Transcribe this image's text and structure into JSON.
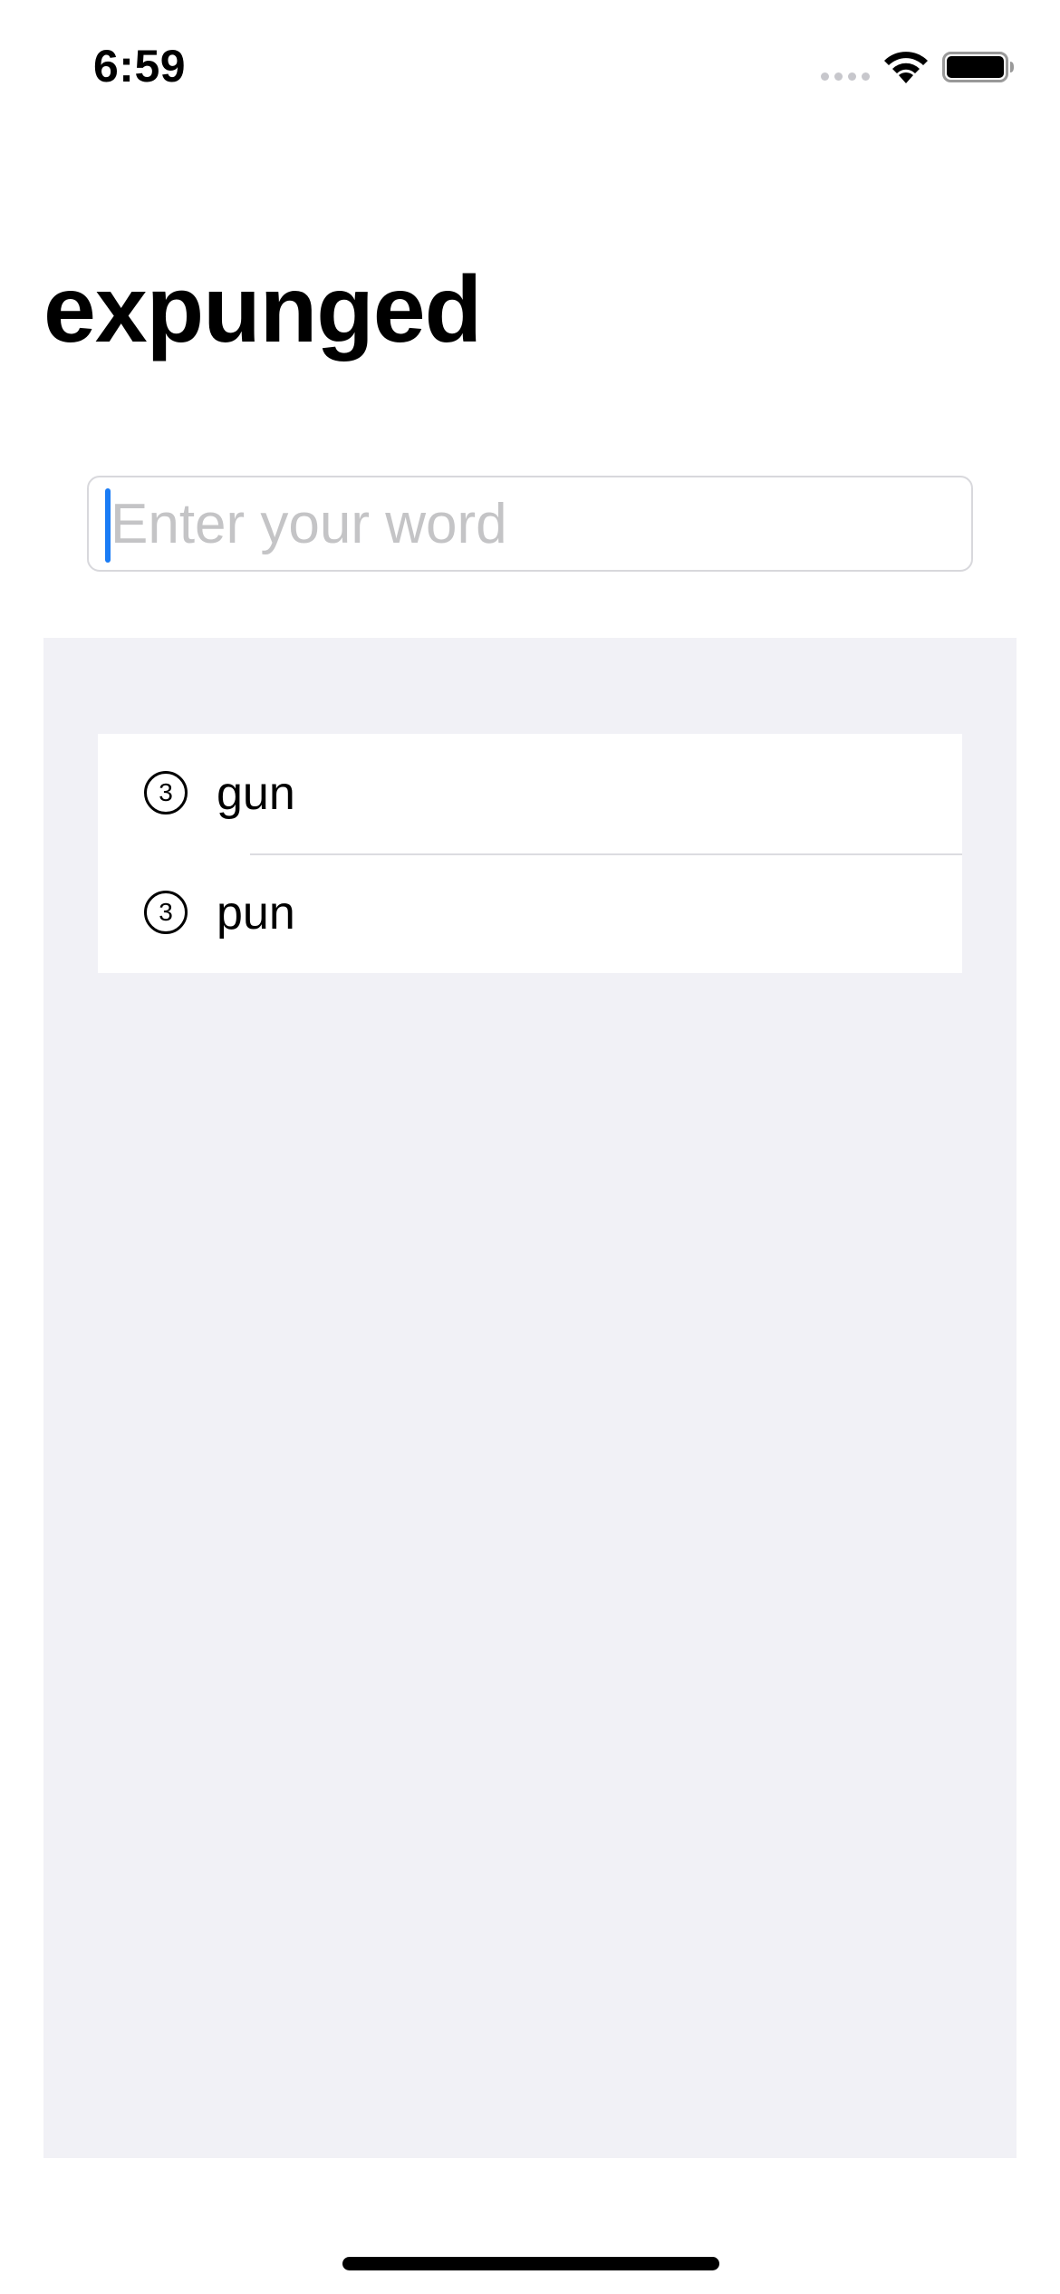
{
  "status_bar": {
    "time": "6:59"
  },
  "page": {
    "title": "expunged"
  },
  "search": {
    "value": "",
    "placeholder": "Enter your word"
  },
  "results": [
    {
      "count": "3",
      "word": "gun"
    },
    {
      "count": "3",
      "word": "pun"
    }
  ],
  "colors": {
    "caret": "#1a7cf5",
    "panel_background": "#f1f1f6",
    "placeholder": "#c4c4c6"
  }
}
